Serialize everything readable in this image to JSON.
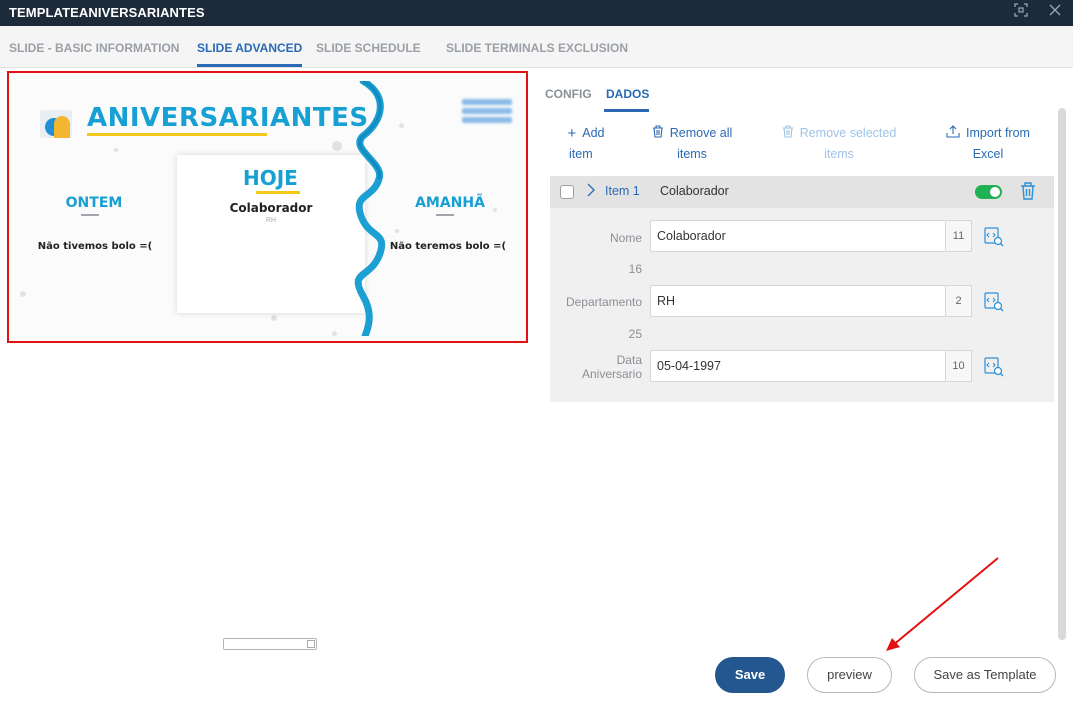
{
  "window": {
    "title": "TEMPLATEANIVERSARIANTES",
    "maximize_icon": "maximize-icon",
    "close_icon": "close-icon"
  },
  "tabs": [
    {
      "label": "SLIDE - BASIC INFORMATION",
      "active": false
    },
    {
      "label": "SLIDE ADVANCED",
      "active": true
    },
    {
      "label": "SLIDE SCHEDULE",
      "active": false
    },
    {
      "label": "SLIDE TERMINALS EXCLUSION",
      "active": false
    }
  ],
  "preview": {
    "title": "ANIVERSARIANTES",
    "yesterday": {
      "heading": "ONTEM",
      "text": "Não tivemos bolo =("
    },
    "today": {
      "heading": "HOJE",
      "name": "Colaborador",
      "department": "RH"
    },
    "tomorrow": {
      "heading": "AMANHÃ",
      "text": "Não teremos bolo =("
    },
    "colors": {
      "accent": "#17a0d3",
      "underline": "#f2c81a",
      "highlight_border": "#e31212"
    }
  },
  "subtabs": [
    {
      "label": "CONFIG",
      "active": false
    },
    {
      "label": "DADOS",
      "active": true
    }
  ],
  "actions": {
    "add": {
      "label_line1": "Add",
      "label_line2": "item",
      "icon": "plus-icon"
    },
    "remove_all": {
      "label_line1": "Remove all",
      "label_line2": "items",
      "icon": "trash-icon"
    },
    "remove_selected": {
      "label_line1": "Remove selected",
      "label_line2": "items",
      "icon": "trash-icon",
      "disabled": true
    },
    "import": {
      "label_line1": "Import from",
      "label_line2": "Excel",
      "icon": "upload-icon"
    }
  },
  "item": {
    "label": "Item 1",
    "name": "Colaborador",
    "enabled": true,
    "fields": [
      {
        "label": "Nome",
        "value": "Colaborador",
        "count": "11",
        "number": "16"
      },
      {
        "label": "Departamento",
        "value": "RH",
        "count": "2",
        "number": "25"
      },
      {
        "label_line1": "Data",
        "label_line2": "Aniversario",
        "value": "05-04-1997",
        "count": "10"
      }
    ]
  },
  "buttons": {
    "save": "Save",
    "preview": "preview",
    "save_template": "Save as Template"
  },
  "colors": {
    "primary": "#2a6ab4",
    "titlebar": "#1c2a3a",
    "toggle_on": "#1fb153",
    "annotation": "#e31212"
  }
}
